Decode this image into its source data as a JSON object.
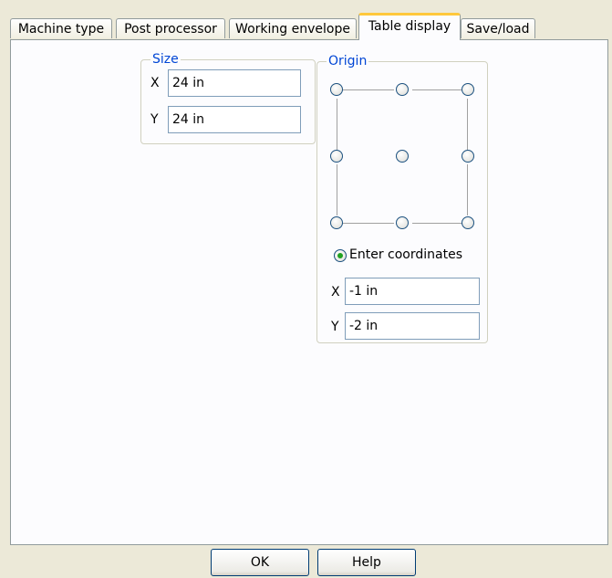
{
  "tabs": [
    {
      "label": "Machine type"
    },
    {
      "label": "Post processor"
    },
    {
      "label": "Working envelope"
    },
    {
      "label": "Table display",
      "active": true
    },
    {
      "label": "Save/load"
    }
  ],
  "size": {
    "legend": "Size",
    "x_label": "X",
    "x_value": "24 in",
    "y_label": "Y",
    "y_value": "24 in"
  },
  "origin": {
    "legend": "Origin",
    "enter_coordinates_label": "Enter coordinates",
    "enter_coordinates_selected": true,
    "x_label": "X",
    "x_value": "-1 in",
    "y_label": "Y",
    "y_value": "-2 in"
  },
  "buttons": {
    "ok": "OK",
    "help": "Help"
  },
  "colors": {
    "active_tab_accent": "#ffc83c",
    "legend_text": "#0046d5",
    "dialog_background": "#ece9d8"
  }
}
